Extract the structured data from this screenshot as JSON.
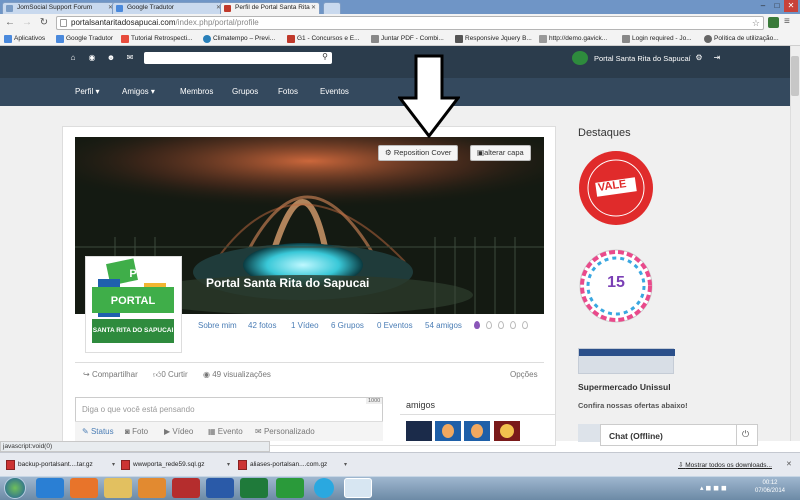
{
  "browser": {
    "tabs": [
      {
        "label": "JomSocial Support Forum",
        "color": "#7a9cc6"
      },
      {
        "label": "Google Tradutor",
        "color": "#4a89dc"
      },
      {
        "label": "Perfil de Portal Santa Rita",
        "color": "#c0392b"
      }
    ],
    "url_host": "portalsantaritadosapucai.com",
    "url_path": "/index.php/portal/profile",
    "bookmarks": [
      {
        "label": "Aplicativos",
        "color": "#4a89dc"
      },
      {
        "label": "Google Tradutor",
        "color": "#4a89dc"
      },
      {
        "label": "Tutorial Retrospecti...",
        "color": "#e74c3c"
      },
      {
        "label": "Climatempo – Previ...",
        "color": "#2980b9"
      },
      {
        "label": "G1 - Concursos e E...",
        "color": "#c0392b"
      },
      {
        "label": "Juntar PDF - Combi...",
        "color": "#888888"
      },
      {
        "label": "Responsive Jquery B...",
        "color": "#555555"
      },
      {
        "label": "http://demo.gavick...",
        "color": "#999999"
      },
      {
        "label": "Login required - Jo...",
        "color": "#888888"
      },
      {
        "label": "Política de utilização...",
        "color": "#666666"
      }
    ]
  },
  "site": {
    "brand": "Portal Santa Rita do Sapucaí",
    "nav": [
      "Perfil",
      "Amigos",
      "Membros",
      "Grupos",
      "Fotos",
      "Eventos"
    ],
    "nav_has_caret": [
      true,
      true,
      false,
      false,
      false,
      false
    ]
  },
  "profile": {
    "reposition_label": "Reposition Cover",
    "change_cover_label": "alterar capa",
    "name": "Portal Santa Rita do Sapucai",
    "avatar_logo_text": "PORTAL",
    "avatar_caption": "SANTA RITA DO SAPUCAI",
    "stats": [
      "Sobre mim",
      "42 fotos",
      "1 Vídeo",
      "6 Grupos",
      "0 Eventos",
      "54 amigos"
    ],
    "share_label": "Compartilhar",
    "like_label": "0 Curtir",
    "views_label": "49 visualizações",
    "options_label": "Opções"
  },
  "composer": {
    "placeholder": "Diga o que você está pensando",
    "char_count": "1000",
    "tabs": [
      "Status",
      "Foto",
      "Vídeo",
      "Evento",
      "Personalizado"
    ]
  },
  "friends": {
    "title": "amigos"
  },
  "sidebar": {
    "title": "Destaques",
    "vale_text": "VALE",
    "badge_number": "15",
    "unissul_title": "Supermercado Unissul",
    "unissul_text": "Confira nossas ofertas abaixo!"
  },
  "chat": {
    "label": "Chat (Offline)"
  },
  "status": "javascript:void(0)",
  "downloads": {
    "items": [
      "backup-portalsant....tar.gz",
      "wwwporta_rede59.sql.gz",
      "aliases-portalsan....com.gz"
    ],
    "show_all": "Mostrar todos os downloads..."
  },
  "clock": {
    "time": "00:12",
    "date": "07/06/2014"
  },
  "colors": {
    "header_dark": "#2b3c4c",
    "nav_bar": "#34495e",
    "link": "#4a7db5",
    "vale_red": "#e02b2b"
  }
}
